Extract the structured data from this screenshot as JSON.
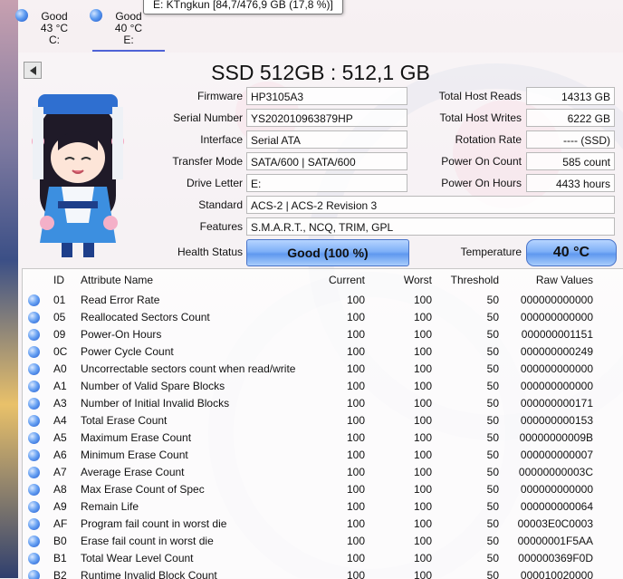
{
  "tabs": [
    {
      "status": "Good",
      "temp": "43 °C",
      "drive": "C:"
    },
    {
      "status": "Good",
      "temp": "40 °C",
      "drive": "E:"
    }
  ],
  "tooltip": "E: KTngkun [84,7/476,9 GB (17,8 %)]",
  "disk_title": "SSD 512GB : 512,1 GB",
  "left_info": {
    "firmware_label": "Firmware",
    "firmware": "HP3105A3",
    "serial_label": "Serial Number",
    "serial": "YS202010963879HP",
    "interface_label": "Interface",
    "interface": "Serial ATA",
    "transfer_label": "Transfer Mode",
    "transfer": "SATA/600 | SATA/600",
    "drive_letter_label": "Drive Letter",
    "drive_letter": "E:",
    "standard_label": "Standard",
    "standard": "ACS-2 | ACS-2 Revision 3",
    "features_label": "Features",
    "features": "S.M.A.R.T., NCQ, TRIM, GPL"
  },
  "right_info": {
    "reads_label": "Total Host Reads",
    "reads": "14313 GB",
    "writes_label": "Total Host Writes",
    "writes": "6222 GB",
    "rotation_label": "Rotation Rate",
    "rotation": "---- (SSD)",
    "count_label": "Power On Count",
    "count": "585 count",
    "hours_label": "Power On Hours",
    "hours": "4433 hours"
  },
  "health_label": "Health Status",
  "health": "Good  (100 %)",
  "temperature_label": "Temperature",
  "temperature": "40 °C",
  "columns": {
    "id": "ID",
    "name": "Attribute Name",
    "current": "Current",
    "worst": "Worst",
    "threshold": "Threshold",
    "raw": "Raw Values"
  },
  "attributes": [
    {
      "id": "01",
      "name": "Read Error Rate",
      "current": "100",
      "worst": "100",
      "threshold": "50",
      "raw": "000000000000"
    },
    {
      "id": "05",
      "name": "Reallocated Sectors Count",
      "current": "100",
      "worst": "100",
      "threshold": "50",
      "raw": "000000000000"
    },
    {
      "id": "09",
      "name": "Power-On Hours",
      "current": "100",
      "worst": "100",
      "threshold": "50",
      "raw": "000000001151"
    },
    {
      "id": "0C",
      "name": "Power Cycle Count",
      "current": "100",
      "worst": "100",
      "threshold": "50",
      "raw": "000000000249"
    },
    {
      "id": "A0",
      "name": "Uncorrectable sectors count when read/write",
      "current": "100",
      "worst": "100",
      "threshold": "50",
      "raw": "000000000000"
    },
    {
      "id": "A1",
      "name": "Number of Valid Spare Blocks",
      "current": "100",
      "worst": "100",
      "threshold": "50",
      "raw": "000000000000"
    },
    {
      "id": "A3",
      "name": "Number of Initial Invalid Blocks",
      "current": "100",
      "worst": "100",
      "threshold": "50",
      "raw": "000000000171"
    },
    {
      "id": "A4",
      "name": "Total Erase Count",
      "current": "100",
      "worst": "100",
      "threshold": "50",
      "raw": "000000000153"
    },
    {
      "id": "A5",
      "name": "Maximum Erase Count",
      "current": "100",
      "worst": "100",
      "threshold": "50",
      "raw": "00000000009B"
    },
    {
      "id": "A6",
      "name": "Minimum Erase Count",
      "current": "100",
      "worst": "100",
      "threshold": "50",
      "raw": "000000000007"
    },
    {
      "id": "A7",
      "name": "Average Erase Count",
      "current": "100",
      "worst": "100",
      "threshold": "50",
      "raw": "00000000003C"
    },
    {
      "id": "A8",
      "name": "Max Erase Count of Spec",
      "current": "100",
      "worst": "100",
      "threshold": "50",
      "raw": "000000000000"
    },
    {
      "id": "A9",
      "name": "Remain Life",
      "current": "100",
      "worst": "100",
      "threshold": "50",
      "raw": "000000000064"
    },
    {
      "id": "AF",
      "name": "Program fail count in worst die",
      "current": "100",
      "worst": "100",
      "threshold": "50",
      "raw": "00003E0C0003"
    },
    {
      "id": "B0",
      "name": "Erase fail count in worst die",
      "current": "100",
      "worst": "100",
      "threshold": "50",
      "raw": "00000001F5AA"
    },
    {
      "id": "B1",
      "name": "Total Wear Level Count",
      "current": "100",
      "worst": "100",
      "threshold": "50",
      "raw": "000000369F0D"
    },
    {
      "id": "B2",
      "name": "Runtime Invalid Block Count",
      "current": "100",
      "worst": "100",
      "threshold": "50",
      "raw": "000010020000"
    }
  ],
  "colors": {
    "good": "#5f98ef",
    "tab_underline": "#4f63d6"
  },
  "icons": {
    "back": "back-arrow-icon",
    "status": "status-good-icon"
  }
}
